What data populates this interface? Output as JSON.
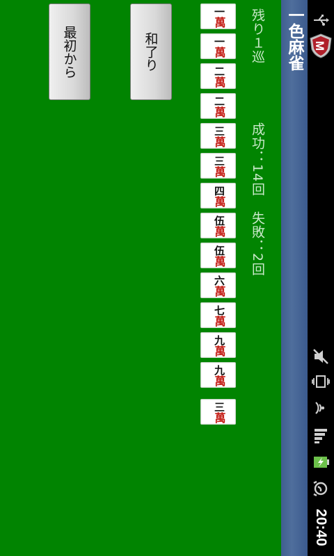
{
  "status_bar": {
    "time": "20:40",
    "icons": [
      "usb-icon",
      "mute-icon",
      "vibrate-icon",
      "wifi-icon",
      "signal-icon",
      "battery-charging-icon",
      "alarm-icon"
    ]
  },
  "app": {
    "title": "一色麻雀",
    "logo_letter": "M"
  },
  "game": {
    "remaining": "残り１巡",
    "success": "成功：14回",
    "fail": "失敗：2回"
  },
  "hand": [
    {
      "rank": "一",
      "suit": "萬"
    },
    {
      "rank": "一",
      "suit": "萬"
    },
    {
      "rank": "二",
      "suit": "萬"
    },
    {
      "rank": "二",
      "suit": "萬"
    },
    {
      "rank": "三",
      "suit": "萬"
    },
    {
      "rank": "三",
      "suit": "萬"
    },
    {
      "rank": "四",
      "suit": "萬"
    },
    {
      "rank": "伍",
      "suit": "萬"
    },
    {
      "rank": "伍",
      "suit": "萬"
    },
    {
      "rank": "六",
      "suit": "萬"
    },
    {
      "rank": "七",
      "suit": "萬"
    },
    {
      "rank": "九",
      "suit": "萬"
    },
    {
      "rank": "九",
      "suit": "萬"
    }
  ],
  "drawn_tile": {
    "rank": "三",
    "suit": "萬"
  },
  "buttons": {
    "win": "和了り",
    "restart": "最初から"
  },
  "colors": {
    "table": "#018401",
    "title_bar": "#4a6898",
    "suit_red": "#c31a12"
  }
}
